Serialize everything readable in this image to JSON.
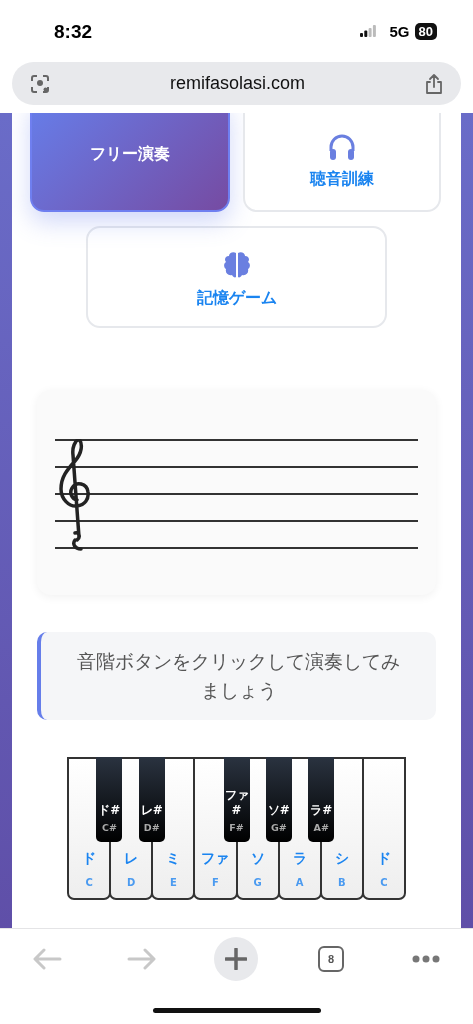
{
  "status_bar": {
    "time": "8:32",
    "network": "5G",
    "battery": "80"
  },
  "address_bar": {
    "url": "remifasolasi.com"
  },
  "modes": [
    {
      "label": "フリー演奏",
      "kind": "free",
      "selected": true
    },
    {
      "label": "聴音訓練",
      "kind": "listening",
      "selected": false
    },
    {
      "label": "記憶ゲーム",
      "kind": "memory",
      "selected": false
    }
  ],
  "message": "音階ボタンをクリックして演奏してみましょう",
  "piano": {
    "white_keys": [
      {
        "solfege": "ド",
        "letter": "C",
        "sharp": {
          "solfege": "ド#",
          "letter": "C#"
        }
      },
      {
        "solfege": "レ",
        "letter": "D",
        "sharp": {
          "solfege": "レ#",
          "letter": "D#"
        }
      },
      {
        "solfege": "ミ",
        "letter": "E"
      },
      {
        "solfege": "ファ",
        "letter": "F",
        "sharp": {
          "solfege": "ファ#",
          "letter": "F#"
        }
      },
      {
        "solfege": "ソ",
        "letter": "G",
        "sharp": {
          "solfege": "ソ#",
          "letter": "G#"
        }
      },
      {
        "solfege": "ラ",
        "letter": "A",
        "sharp": {
          "solfege": "ラ#",
          "letter": "A#"
        }
      },
      {
        "solfege": "シ",
        "letter": "B"
      },
      {
        "solfege": "ド",
        "letter": "C"
      }
    ]
  },
  "toolbar": {
    "tab_count": "8"
  }
}
